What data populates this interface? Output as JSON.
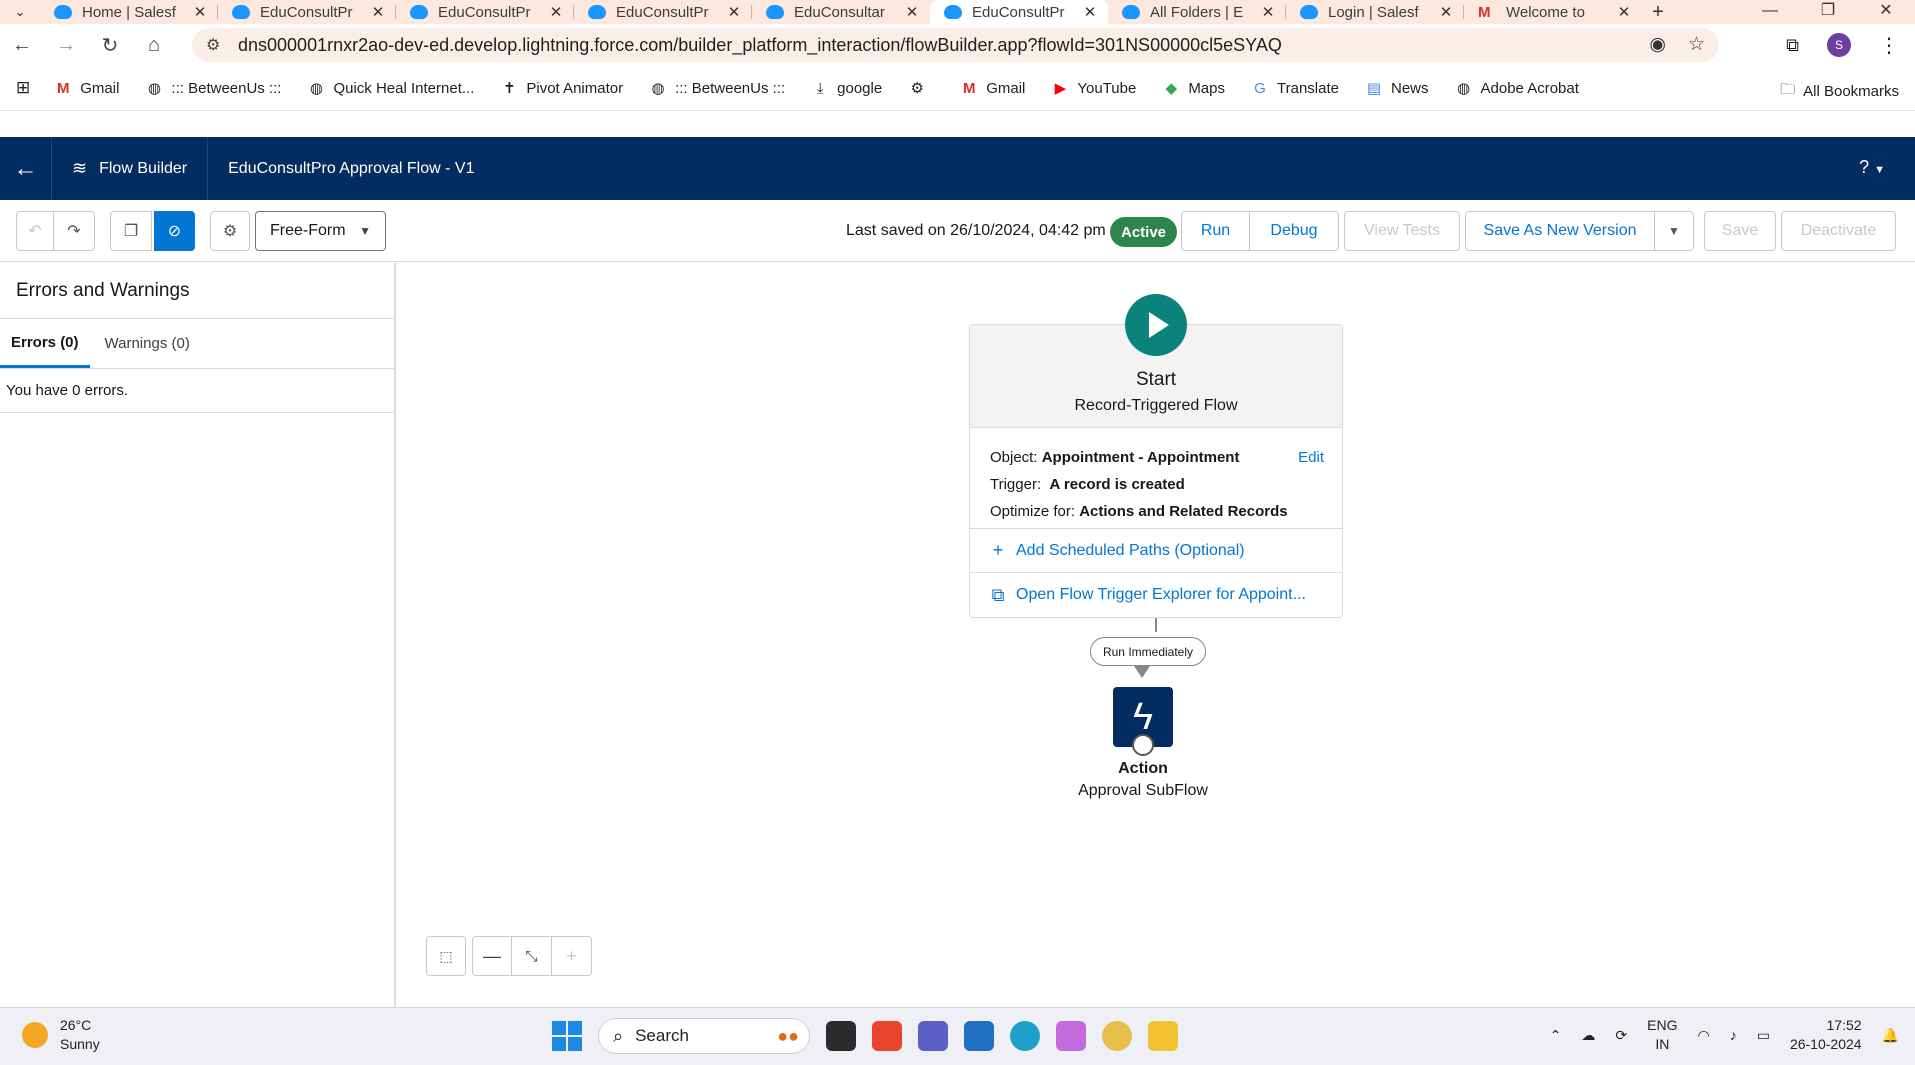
{
  "browser": {
    "tabs": [
      {
        "title": "Home | Salesf",
        "icon": "salesforce-cloud",
        "active": false
      },
      {
        "title": "EduConsultPr",
        "icon": "salesforce-cloud",
        "active": false
      },
      {
        "title": "EduConsultPr",
        "icon": "salesforce-cloud",
        "active": false
      },
      {
        "title": "EduConsultPr",
        "icon": "salesforce-cloud",
        "active": false
      },
      {
        "title": "EduConsultar",
        "icon": "salesforce-cloud",
        "active": false
      },
      {
        "title": "EduConsultPr",
        "icon": "salesforce-cloud",
        "active": true
      },
      {
        "title": "All Folders | E",
        "icon": "salesforce-cloud",
        "active": false
      },
      {
        "title": "Login | Salesf",
        "icon": "salesforce-cloud",
        "active": false
      },
      {
        "title": "Welcome to",
        "icon": "gmail",
        "active": false
      }
    ],
    "url": "dns000001rnxr2ao-dev-ed.develop.lightning.force.com/builder_platform_interaction/flowBuilder.app?flowId=301NS00000cl5eSYAQ",
    "profile_initial": "S",
    "bookmarks": [
      {
        "label": "Gmail",
        "icon": "gmail-icon"
      },
      {
        "label": "::: BetweenUs :::",
        "icon": "globe-icon"
      },
      {
        "label": "Quick Heal Internet...",
        "icon": "globe-icon"
      },
      {
        "label": "Pivot Animator",
        "icon": "stickman-icon"
      },
      {
        "label": "::: BetweenUs :::",
        "icon": "globe-icon"
      },
      {
        "label": "google",
        "icon": "download-icon"
      },
      {
        "label": "",
        "icon": "gear-icon"
      },
      {
        "label": "Gmail",
        "icon": "gmail-icon"
      },
      {
        "label": "YouTube",
        "icon": "youtube-icon"
      },
      {
        "label": "Maps",
        "icon": "maps-icon"
      },
      {
        "label": "Translate",
        "icon": "translate-icon"
      },
      {
        "label": "News",
        "icon": "news-icon"
      },
      {
        "label": "Adobe Acrobat",
        "icon": "globe-icon"
      }
    ],
    "all_bookmarks": "All Bookmarks"
  },
  "header": {
    "app_name": "Flow Builder",
    "flow_name": "EduConsultPro Approval Flow - V1",
    "help": "?"
  },
  "toolbar": {
    "layout_mode": "Free-Form",
    "last_saved": "Last saved on 26/10/2024, 04:42 pm",
    "status": "Active",
    "run": "Run",
    "debug": "Debug",
    "view_tests": "View Tests",
    "save_as_new_version": "Save As New Version",
    "save": "Save",
    "deactivate": "Deactivate"
  },
  "left_panel": {
    "title": "Errors and Warnings",
    "tabs": [
      {
        "label": "Errors (0)",
        "active": true
      },
      {
        "label": "Warnings (0)",
        "active": false
      }
    ],
    "message": "You have 0 errors."
  },
  "canvas": {
    "start": {
      "title": "Start",
      "subtitle": "Record-Triggered Flow",
      "object_label": "Object:",
      "object_value": "Appointment - Appointment",
      "edit": "Edit",
      "trigger_label": "Trigger:",
      "trigger_value": "A record is created",
      "optimize_label": "Optimize for:",
      "optimize_value": "Actions and Related Records",
      "add_scheduled_paths": "Add Scheduled Paths (Optional)",
      "open_explorer": "Open Flow Trigger Explorer for Appoint..."
    },
    "connector_label": "Run Immediately",
    "action": {
      "type": "Action",
      "name": "Approval SubFlow"
    }
  },
  "taskbar": {
    "weather_temp": "26°C",
    "weather_desc": "Sunny",
    "search": "Search",
    "lang_1": "ENG",
    "lang_2": "IN",
    "time": "17:52",
    "date": "26-10-2024"
  }
}
